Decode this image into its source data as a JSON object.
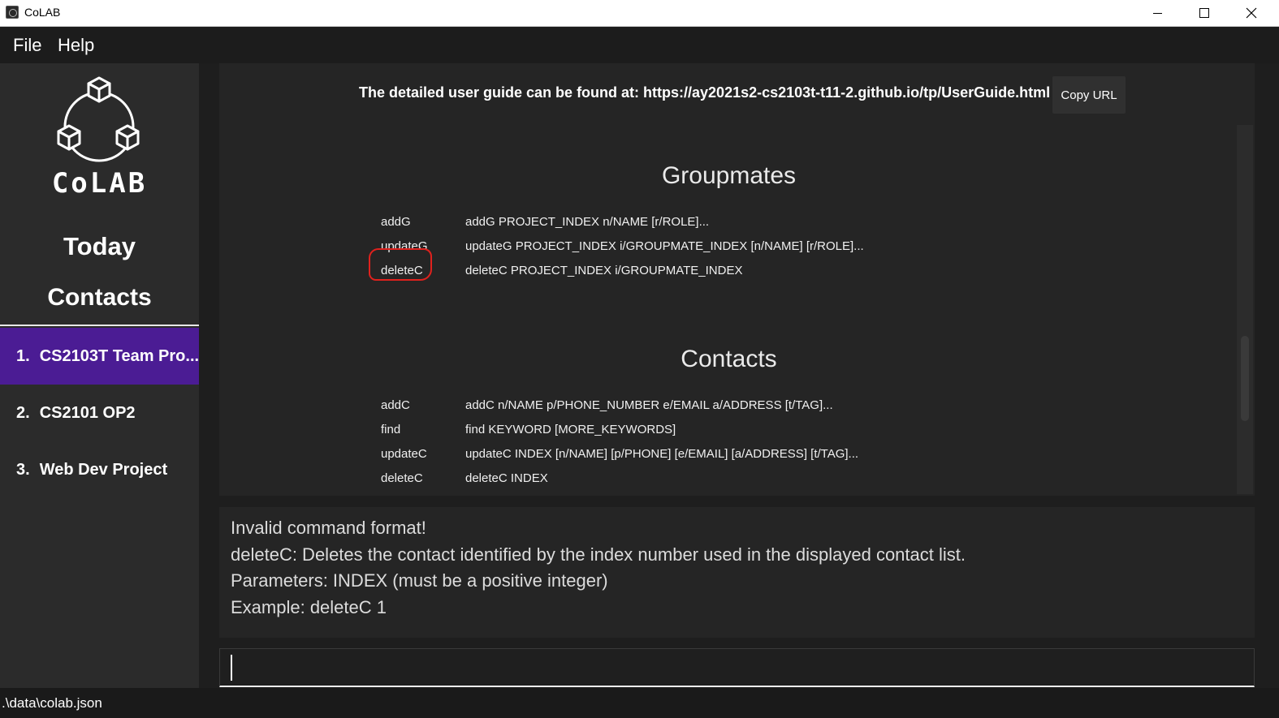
{
  "window": {
    "title": "CoLAB",
    "icons": {
      "app": "colab-app-icon",
      "minimize": "minimize-icon",
      "maximize": "maximize-icon",
      "close": "close-icon"
    }
  },
  "menu": {
    "file": "File",
    "help": "Help"
  },
  "sidebar": {
    "logo_text": "CoLAB",
    "logo_icon": "colab-logo-icon",
    "today": "Today",
    "contacts": "Contacts",
    "projects": [
      {
        "number": "1.",
        "name": "CS2103T Team Pro...",
        "selected": true
      },
      {
        "number": "2.",
        "name": "CS2101 OP2",
        "selected": false
      },
      {
        "number": "3.",
        "name": "Web Dev Project",
        "selected": false
      }
    ],
    "selected_color": "#4b1c94"
  },
  "help": {
    "guide_text": "The detailed user guide can be found at: https://ay2021s2-cs2103t-t11-2.github.io/tp/UserGuide.html",
    "copy_button": "Copy URL",
    "sections": [
      {
        "title": "Groupmates",
        "commands": [
          {
            "name": "addG",
            "usage": "addG PROJECT_INDEX n/NAME [r/ROLE]..."
          },
          {
            "name": "updateG",
            "usage": "updateG PROJECT_INDEX i/GROUPMATE_INDEX [n/NAME] [r/ROLE]..."
          },
          {
            "name": "deleteC",
            "usage": "deleteC PROJECT_INDEX i/GROUPMATE_INDEX"
          }
        ]
      },
      {
        "title": "Contacts",
        "commands": [
          {
            "name": "addC",
            "usage": "addC n/NAME p/PHONE_NUMBER e/EMAIL a/ADDRESS [t/TAG]..."
          },
          {
            "name": "find",
            "usage": "find KEYWORD [MORE_KEYWORDS]"
          },
          {
            "name": "updateC",
            "usage": "updateC INDEX [n/NAME] [p/PHONE] [e/EMAIL] [a/ADDRESS] [t/TAG]..."
          },
          {
            "name": "deleteC",
            "usage": "deleteC INDEX"
          }
        ]
      }
    ],
    "annotation_color": "#e0211d"
  },
  "result": {
    "lines": [
      "Invalid command format!",
      "deleteC: Deletes the contact identified by the index number used in the displayed contact list.",
      "Parameters: INDEX (must be a positive integer)",
      "Example: deleteC 1"
    ]
  },
  "command_box": {
    "value": ""
  },
  "status_bar": {
    "path": ".\\data\\colab.json"
  }
}
